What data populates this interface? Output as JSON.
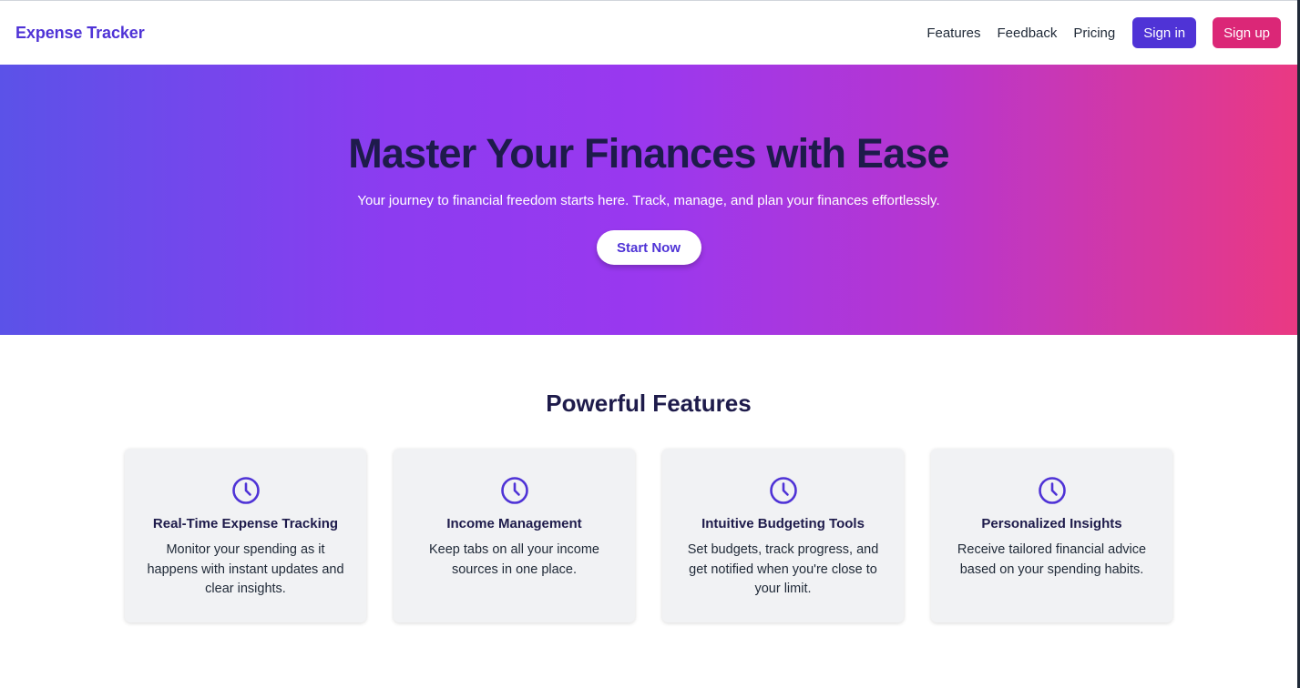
{
  "nav": {
    "brand": "Expense Tracker",
    "links": [
      "Features",
      "Feedback",
      "Pricing"
    ],
    "signin_label": "Sign in",
    "signup_label": "Sign up"
  },
  "hero": {
    "title": "Master Your Finances with Ease",
    "subtitle": "Your journey to financial freedom starts here. Track, manage, and plan your finances effortlessly.",
    "cta_label": "Start Now"
  },
  "features": {
    "heading": "Powerful Features",
    "cards": [
      {
        "icon": "clock-icon",
        "title": "Real-Time Expense Tracking",
        "description": "Monitor your spending as it happens with instant updates and clear insights."
      },
      {
        "icon": "clock-icon",
        "title": "Income Management",
        "description": "Keep tabs on all your income sources in one place."
      },
      {
        "icon": "clock-icon",
        "title": "Intuitive Budgeting Tools",
        "description": "Set budgets, track progress, and get notified when you're close to your limit."
      },
      {
        "icon": "clock-icon",
        "title": "Personalized Insights",
        "description": "Receive tailored financial advice based on your spending habits."
      }
    ]
  },
  "colors": {
    "brand": "#4f33d6",
    "signup": "#db2777",
    "heading": "#1e1b4b",
    "card_bg": "#f1f2f4"
  }
}
